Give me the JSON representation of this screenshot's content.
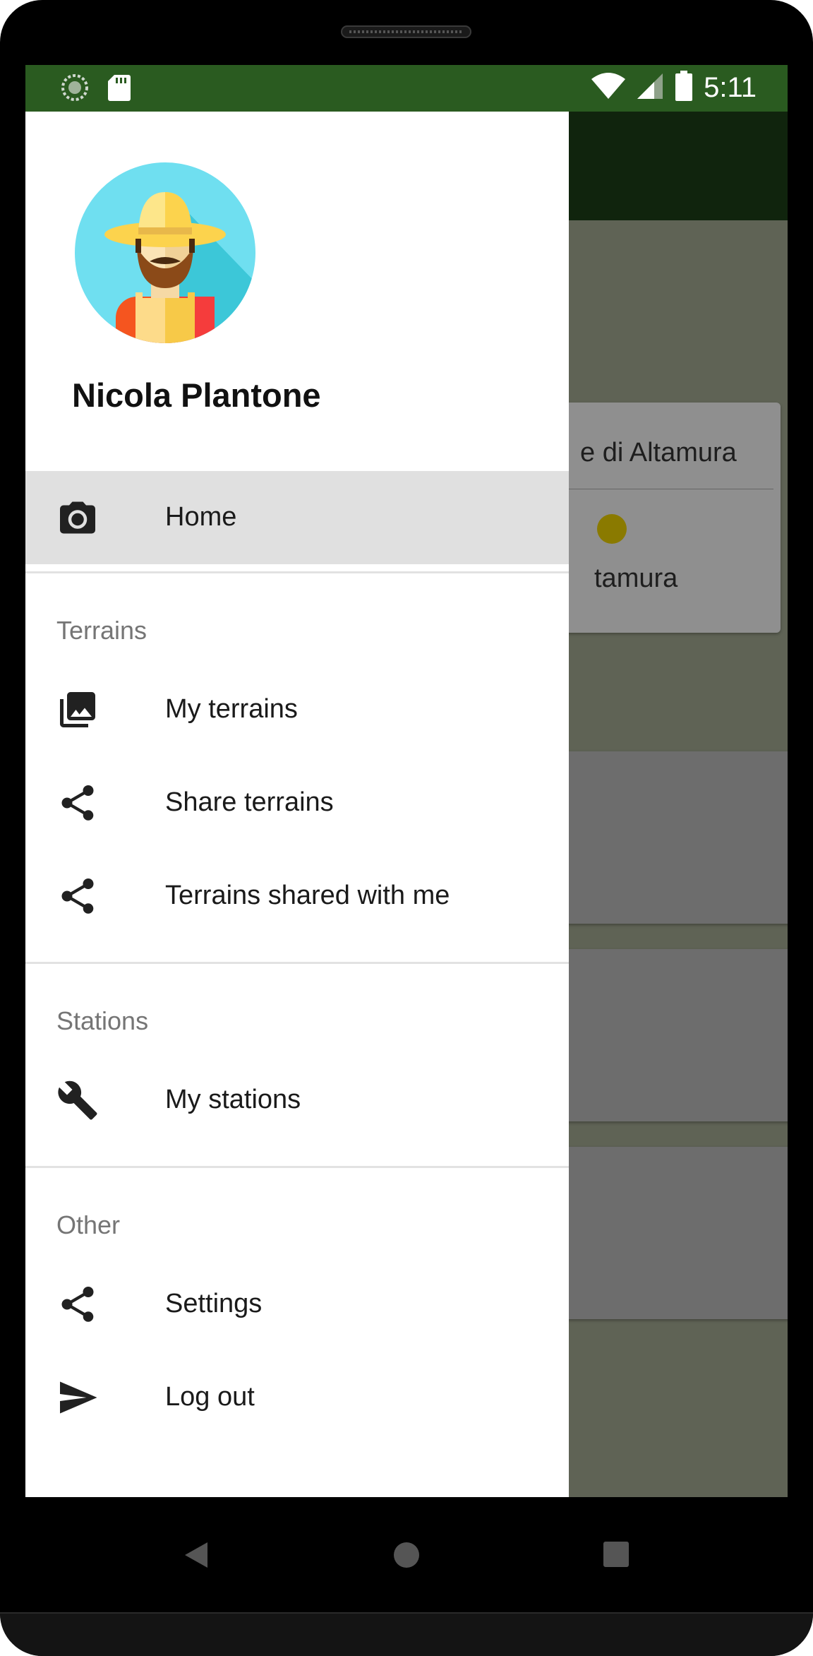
{
  "status_bar": {
    "time": "5:11",
    "left_icons": [
      "sync-icon",
      "sd-card-icon"
    ],
    "right_icons": [
      "wifi-icon",
      "cell-signal-icon",
      "battery-icon"
    ],
    "background_color": "#2a5b20"
  },
  "background_app": {
    "cards": [
      {
        "title": "e di Altamura",
        "subtitle": "tamura",
        "dot_color": "#8a7a00"
      }
    ]
  },
  "drawer": {
    "user_name": "Nicola Plantone",
    "avatar": "farmer-avatar",
    "home": {
      "label": "Home",
      "icon": "camera-icon",
      "selected": true
    },
    "sections": [
      {
        "title": "Terrains",
        "items": [
          {
            "label": "My terrains",
            "icon": "photo-library-icon"
          },
          {
            "label": "Share terrains",
            "icon": "share-icon"
          },
          {
            "label": "Terrains shared with me",
            "icon": "share-icon"
          }
        ]
      },
      {
        "title": "Stations",
        "items": [
          {
            "label": "My stations",
            "icon": "wrench-icon"
          }
        ]
      },
      {
        "title": "Other",
        "items": [
          {
            "label": "Settings",
            "icon": "share-icon"
          },
          {
            "label": "Log out",
            "icon": "send-icon"
          }
        ]
      }
    ]
  },
  "nav_bar": {
    "buttons": [
      "back-icon",
      "home-icon",
      "recents-icon"
    ]
  },
  "colors": {
    "toolbar": "#10240d",
    "selected_item": "#e0e0e0",
    "section_title": "#757575"
  }
}
